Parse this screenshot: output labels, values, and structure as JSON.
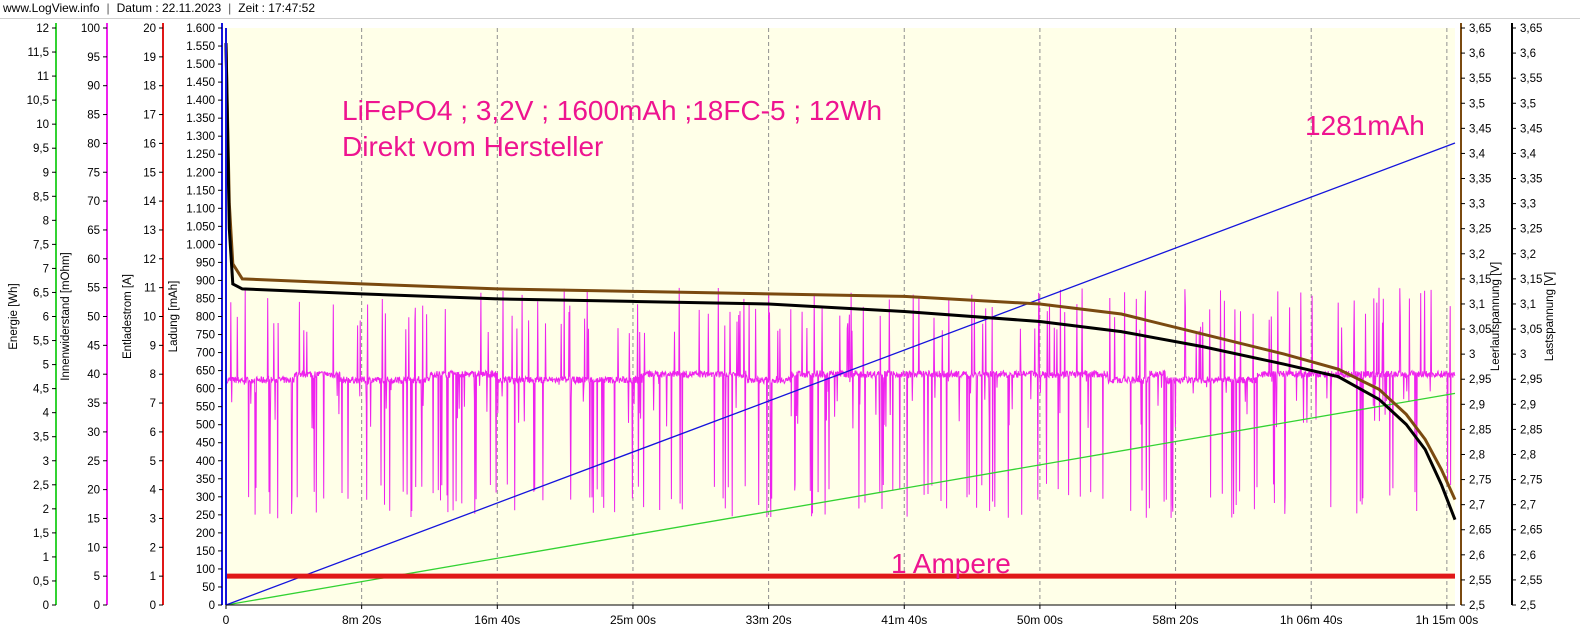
{
  "header": {
    "site": "www.LogView.info",
    "date_label": "Datum : 22.11.2023",
    "time_label": "Zeit : 17:47:52"
  },
  "colors": {
    "plot_bg": "#ffffe8",
    "capacity": "#1414dc",
    "energy": "#32d232",
    "current": "#e01818",
    "resistance": "#ee22ee",
    "ocv": "#7a4a10",
    "load_voltage": "#000000",
    "annotation": "#ee1490"
  },
  "chart_data": {
    "type": "line",
    "x_unit": "s",
    "xlim": [
      0,
      4530
    ],
    "x_ticks": [
      {
        "value": 0,
        "label": "0"
      },
      {
        "value": 500,
        "label": "8m 20s"
      },
      {
        "value": 1000,
        "label": "16m 40s"
      },
      {
        "value": 1500,
        "label": "25m 00s"
      },
      {
        "value": 2000,
        "label": "33m 20s"
      },
      {
        "value": 2500,
        "label": "41m 40s"
      },
      {
        "value": 3000,
        "label": "50m 00s"
      },
      {
        "value": 3500,
        "label": "58m 20s"
      },
      {
        "value": 4000,
        "label": "1h 06m 40s"
      },
      {
        "value": 4500,
        "label": "1h 15m 00s"
      }
    ],
    "axes": {
      "energy": {
        "label": "Energie [Wh]",
        "min": 0,
        "max": 12,
        "ticks": [
          "0",
          "0,5",
          "1",
          "1,5",
          "2",
          "2,5",
          "3",
          "3,5",
          "4",
          "4,5",
          "5",
          "5,5",
          "6",
          "6,5",
          "7",
          "7,5",
          "8",
          "8,5",
          "9",
          "9,5",
          "10",
          "10,5",
          "11",
          "11,5",
          "12"
        ]
      },
      "resistance": {
        "label": "Innenwiderstand [mOhm]",
        "min": 0,
        "max": 100,
        "ticks": [
          "0",
          "5",
          "10",
          "15",
          "20",
          "25",
          "30",
          "35",
          "40",
          "45",
          "50",
          "55",
          "60",
          "65",
          "70",
          "75",
          "80",
          "85",
          "90",
          "95",
          "100"
        ]
      },
      "current": {
        "label": "Entladestrom [A]",
        "min": 0,
        "max": 20,
        "ticks": [
          "0",
          "1",
          "2",
          "3",
          "4",
          "5",
          "6",
          "7",
          "8",
          "9",
          "10",
          "11",
          "12",
          "13",
          "14",
          "15",
          "16",
          "17",
          "18",
          "19",
          "20"
        ]
      },
      "capacity": {
        "label": "Ladung [mAh]",
        "min": 0,
        "max": 1600,
        "ticks": [
          "0",
          "50",
          "100",
          "150",
          "200",
          "250",
          "300",
          "350",
          "400",
          "450",
          "500",
          "550",
          "600",
          "650",
          "700",
          "750",
          "800",
          "850",
          "900",
          "950",
          "1.000",
          "1.050",
          "1.100",
          "1.150",
          "1.200",
          "1.250",
          "1.300",
          "1.350",
          "1.400",
          "1.450",
          "1.500",
          "1.550",
          "1.600"
        ]
      },
      "ocv": {
        "label": "Leerlaufspannung [V]",
        "min": 2.5,
        "max": 3.65,
        "ticks": [
          "2,5",
          "2,55",
          "2,6",
          "2,65",
          "2,7",
          "2,75",
          "2,8",
          "2,85",
          "2,9",
          "2,95",
          "3",
          "3,05",
          "3,1",
          "3,15",
          "3,2",
          "3,25",
          "3,3",
          "3,35",
          "3,4",
          "3,45",
          "3,5",
          "3,55",
          "3,6",
          "3,65"
        ]
      },
      "load_voltage": {
        "label": "Lastspannung [V]",
        "min": 2.5,
        "max": 3.65,
        "ticks": [
          "2,5",
          "2,55",
          "2,6",
          "2,65",
          "2,7",
          "2,75",
          "2,8",
          "2,85",
          "2,9",
          "2,95",
          "3",
          "3,05",
          "3,1",
          "3,15",
          "3,2",
          "3,25",
          "3,3",
          "3,35",
          "3,4",
          "3,45",
          "3,5",
          "3,55",
          "3,6",
          "3,65"
        ]
      }
    },
    "series": [
      {
        "key": "capacity",
        "axis": "capacity",
        "points": [
          [
            0,
            0
          ],
          [
            4530,
            1281
          ]
        ]
      },
      {
        "key": "energy",
        "axis": "energy",
        "points": [
          [
            0,
            0
          ],
          [
            4530,
            4.4
          ]
        ]
      },
      {
        "key": "current",
        "axis": "current",
        "points": [
          [
            0,
            1.0
          ],
          [
            4530,
            1.0
          ]
        ]
      },
      {
        "key": "ocv",
        "axis": "ocv",
        "points": [
          [
            0,
            3.62
          ],
          [
            12,
            3.3
          ],
          [
            25,
            3.18
          ],
          [
            60,
            3.15
          ],
          [
            500,
            3.14
          ],
          [
            1000,
            3.13
          ],
          [
            1500,
            3.125
          ],
          [
            2000,
            3.12
          ],
          [
            2500,
            3.115
          ],
          [
            3000,
            3.1
          ],
          [
            3300,
            3.08
          ],
          [
            3600,
            3.04
          ],
          [
            3900,
            3.0
          ],
          [
            4100,
            2.97
          ],
          [
            4250,
            2.93
          ],
          [
            4350,
            2.88
          ],
          [
            4420,
            2.83
          ],
          [
            4480,
            2.77
          ],
          [
            4530,
            2.71
          ]
        ]
      },
      {
        "key": "load_voltage",
        "axis": "load_voltage",
        "points": [
          [
            0,
            3.62
          ],
          [
            12,
            3.25
          ],
          [
            25,
            3.14
          ],
          [
            60,
            3.13
          ],
          [
            500,
            3.12
          ],
          [
            1000,
            3.11
          ],
          [
            1500,
            3.105
          ],
          [
            2000,
            3.1
          ],
          [
            2500,
            3.085
          ],
          [
            3000,
            3.065
          ],
          [
            3300,
            3.045
          ],
          [
            3600,
            3.015
          ],
          [
            3900,
            2.98
          ],
          [
            4100,
            2.955
          ],
          [
            4250,
            2.91
          ],
          [
            4350,
            2.86
          ],
          [
            4420,
            2.81
          ],
          [
            4480,
            2.74
          ],
          [
            4530,
            2.67
          ]
        ]
      },
      {
        "key": "resistance",
        "axis": "resistance",
        "base_levels": [
          [
            0,
            39
          ],
          [
            50,
            39
          ],
          [
            250,
            39
          ],
          [
            251,
            40
          ],
          [
            420,
            40
          ],
          [
            421,
            39
          ],
          [
            750,
            39
          ],
          [
            751,
            40
          ],
          [
            1000,
            40
          ],
          [
            1001,
            39
          ],
          [
            1520,
            39
          ],
          [
            1521,
            40
          ],
          [
            1920,
            40
          ],
          [
            1921,
            39
          ],
          [
            2080,
            39
          ],
          [
            2081,
            40
          ],
          [
            3250,
            40
          ],
          [
            3251,
            39
          ],
          [
            3400,
            39
          ],
          [
            3401,
            40
          ],
          [
            3460,
            40
          ],
          [
            3461,
            39
          ],
          [
            3800,
            39
          ],
          [
            3801,
            40
          ],
          [
            4530,
            40
          ]
        ],
        "note": "noisy, alternating between roughly 15 and 45 mOhm with spikes to about 55 mOhm"
      }
    ],
    "annotations": [
      "LiFePO4 ; 3,2V ; 1600mAh ;18FC-5 ; 12Wh",
      "Direkt vom Hersteller",
      "1281mAh",
      "1 Ampere"
    ],
    "grid": {
      "vertical": true,
      "horizontal": false
    },
    "legend": "none"
  }
}
